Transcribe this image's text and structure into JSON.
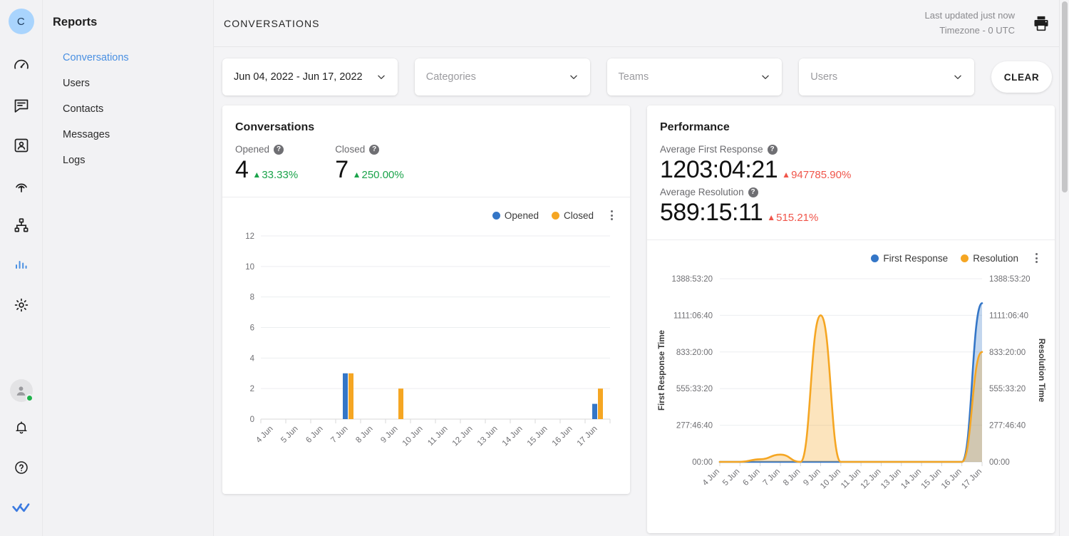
{
  "rail": {
    "workspace_initial": "C",
    "icons": [
      {
        "name": "dashboard-icon",
        "label": "Dashboard"
      },
      {
        "name": "conversations-icon",
        "label": "Conversations"
      },
      {
        "name": "contacts-icon",
        "label": "Contacts"
      },
      {
        "name": "campaigns-icon",
        "label": "Campaigns"
      },
      {
        "name": "portals-icon",
        "label": "Portals"
      },
      {
        "name": "reports-icon",
        "label": "Reports"
      },
      {
        "name": "settings-icon",
        "label": "Settings"
      }
    ],
    "bottom": [
      {
        "name": "profile-avatar",
        "label": "Profile"
      },
      {
        "name": "notifications-bell-icon",
        "label": "Notifications"
      },
      {
        "name": "help-icon",
        "label": "Help"
      },
      {
        "name": "brand-logo-icon",
        "label": "Chatwoot"
      }
    ]
  },
  "sidebar": {
    "title": "Reports",
    "items": [
      {
        "label": "Conversations",
        "active": true
      },
      {
        "label": "Users",
        "active": false
      },
      {
        "label": "Contacts",
        "active": false
      },
      {
        "label": "Messages",
        "active": false
      },
      {
        "label": "Logs",
        "active": false
      }
    ]
  },
  "header": {
    "title": "CONVERSATIONS",
    "last_updated": "Last updated just now",
    "timezone": "Timezone - 0 UTC",
    "print_icon": "printer-icon"
  },
  "filters": {
    "date_range": "Jun 04, 2022 - Jun 17, 2022",
    "categories_placeholder": "Categories",
    "teams_placeholder": "Teams",
    "users_placeholder": "Users",
    "clear_label": "CLEAR",
    "chevron_icon": "chevron-down-icon"
  },
  "conversations_card": {
    "title": "Conversations",
    "metrics": [
      {
        "label": "Opened",
        "value": "4",
        "delta": "33.33%",
        "direction": "up",
        "tone": "good"
      },
      {
        "label": "Closed",
        "value": "7",
        "delta": "250.00%",
        "direction": "up",
        "tone": "good"
      }
    ],
    "legend": [
      {
        "label": "Opened",
        "color": "#3476c7"
      },
      {
        "label": "Closed",
        "color": "#f5a623"
      }
    ],
    "menu_icon": "kebab-menu-icon"
  },
  "performance_card": {
    "title": "Performance",
    "metrics": [
      {
        "label": "Average First Response",
        "value": "1203:04:21",
        "delta": "947785.90%",
        "direction": "up",
        "tone": "bad"
      },
      {
        "label": "Average Resolution",
        "value": "589:15:11",
        "delta": "515.21%",
        "direction": "up",
        "tone": "bad"
      }
    ],
    "legend": [
      {
        "label": "First Response",
        "color": "#3476c7"
      },
      {
        "label": "Resolution",
        "color": "#f5a623"
      }
    ],
    "menu_icon": "kebab-menu-icon"
  },
  "chart_data": [
    {
      "type": "bar",
      "title": "Conversations",
      "categories": [
        "4 Jun",
        "5 Jun",
        "6 Jun",
        "7 Jun",
        "8 Jun",
        "9 Jun",
        "10 Jun",
        "11 Jun",
        "12 Jun",
        "13 Jun",
        "14 Jun",
        "15 Jun",
        "16 Jun",
        "17 Jun"
      ],
      "series": [
        {
          "name": "Opened",
          "color": "#3476c7",
          "values": [
            0,
            0,
            0,
            3,
            0,
            0,
            0,
            0,
            0,
            0,
            0,
            0,
            0,
            1
          ]
        },
        {
          "name": "Closed",
          "color": "#f5a623",
          "values": [
            0,
            0,
            0,
            3,
            0,
            2,
            0,
            0,
            0,
            0,
            0,
            0,
            0,
            2
          ]
        }
      ],
      "xlabel": "",
      "ylabel": "",
      "ylim": [
        0,
        12
      ],
      "yticks": [
        0,
        2,
        4,
        6,
        8,
        10,
        12
      ],
      "ytick_labels": [
        "0",
        "2",
        "4",
        "6",
        "8",
        "10",
        "12"
      ],
      "grid": true,
      "legend_position": "top-right"
    },
    {
      "type": "area",
      "title": "Performance",
      "categories": [
        "4 Jun",
        "5 Jun",
        "6 Jun",
        "7 Jun",
        "8 Jun",
        "9 Jun",
        "10 Jun",
        "11 Jun",
        "12 Jun",
        "13 Jun",
        "14 Jun",
        "15 Jun",
        "16 Jun",
        "17 Jun"
      ],
      "series": [
        {
          "name": "First Response",
          "color": "#3476c7",
          "axis": "left",
          "values": [
            0,
            0,
            0,
            0,
            0,
            0,
            0,
            0,
            0,
            0,
            0,
            0,
            0,
            1203.07
          ]
        },
        {
          "name": "Resolution",
          "color": "#f5a623",
          "axis": "right",
          "values": [
            0,
            0,
            20,
            55,
            0,
            1111.11,
            0,
            0,
            0,
            0,
            0,
            0,
            0,
            833.33
          ]
        }
      ],
      "xlabel": "",
      "ylabel": "First Response Time",
      "y2label": "Resolution Time",
      "ylim": [
        0,
        1388.89
      ],
      "yticks": [
        0,
        277.78,
        555.56,
        833.33,
        1111.11,
        1388.89
      ],
      "ytick_labels": [
        "00:00",
        "277:46:40",
        "555:33:20",
        "833:20:00",
        "1111:06:40",
        "1388:53:20"
      ],
      "y2tick_labels": [
        "00:00",
        "277:46:40",
        "555:33:20",
        "833:20:00",
        "1111:06:40",
        "1388:53:20"
      ],
      "grid": true,
      "legend_position": "top-right"
    }
  ],
  "colors": {
    "accent": "#4a90e2",
    "series_blue": "#3476c7",
    "series_orange": "#f5a623",
    "positive": "#1aa34a",
    "negative": "#f0554a"
  }
}
